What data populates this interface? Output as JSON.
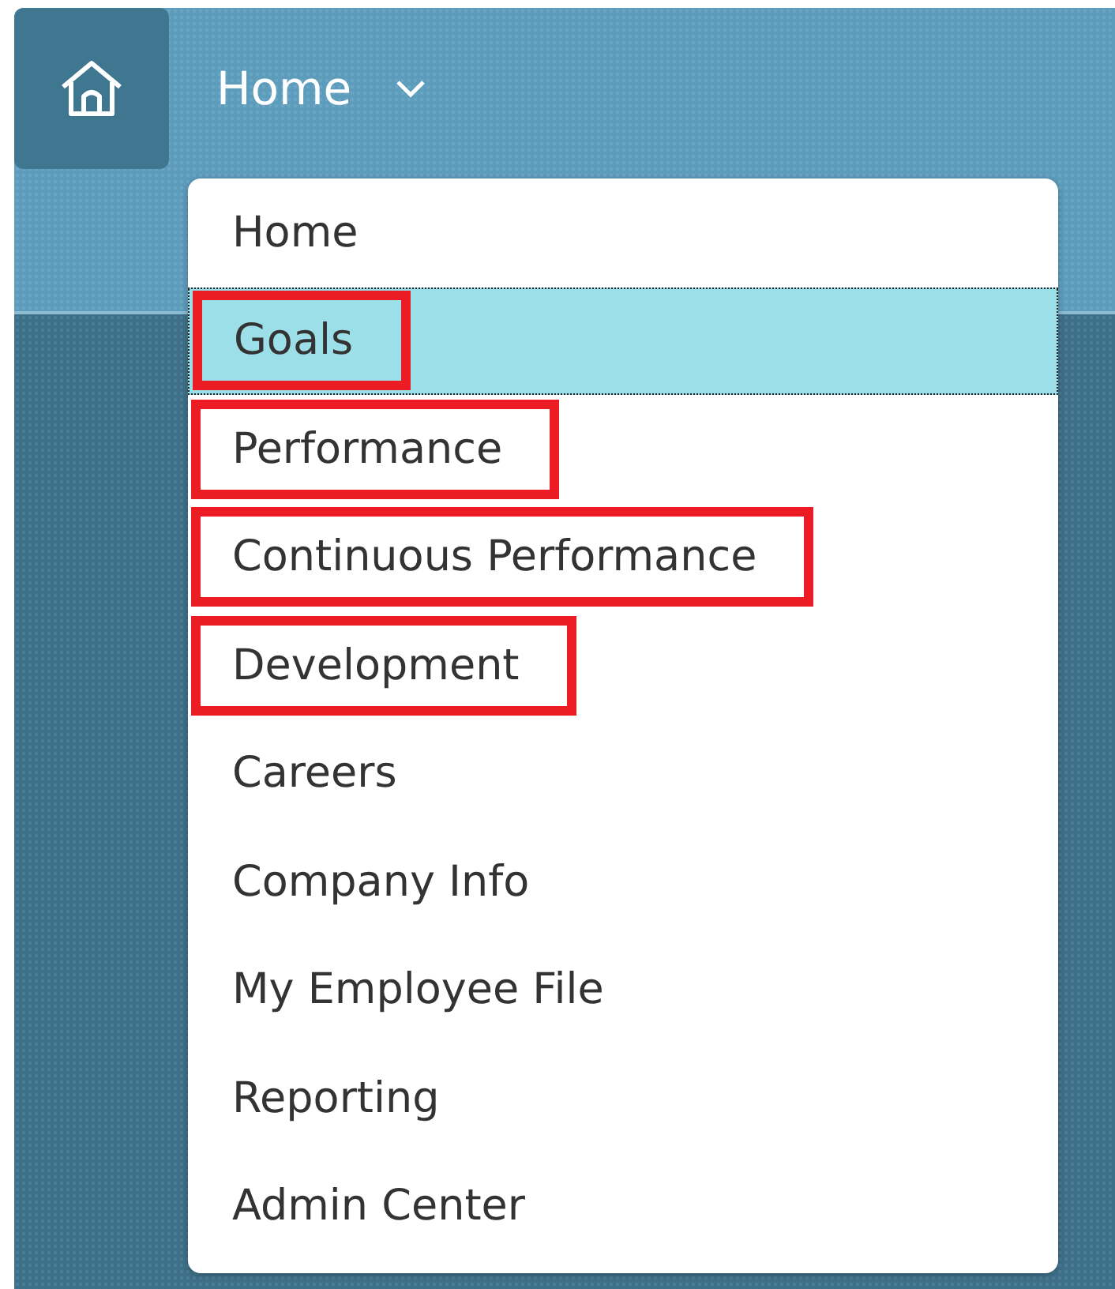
{
  "header": {
    "nav_label": "Home",
    "menu_open": true
  },
  "menu": [
    {
      "label": "Home",
      "selected": false,
      "highlighted": false
    },
    {
      "label": "Goals",
      "selected": true,
      "highlighted": true
    },
    {
      "label": "Performance",
      "selected": false,
      "highlighted": true
    },
    {
      "label": "Continuous Performance",
      "selected": false,
      "highlighted": true
    },
    {
      "label": "Development",
      "selected": false,
      "highlighted": true
    },
    {
      "label": "Careers",
      "selected": false,
      "highlighted": false
    },
    {
      "label": "Company Info",
      "selected": false,
      "highlighted": false
    },
    {
      "label": "My Employee File",
      "selected": false,
      "highlighted": false
    },
    {
      "label": "Reporting",
      "selected": false,
      "highlighted": false
    },
    {
      "label": "Admin Center",
      "selected": false,
      "highlighted": false
    }
  ]
}
